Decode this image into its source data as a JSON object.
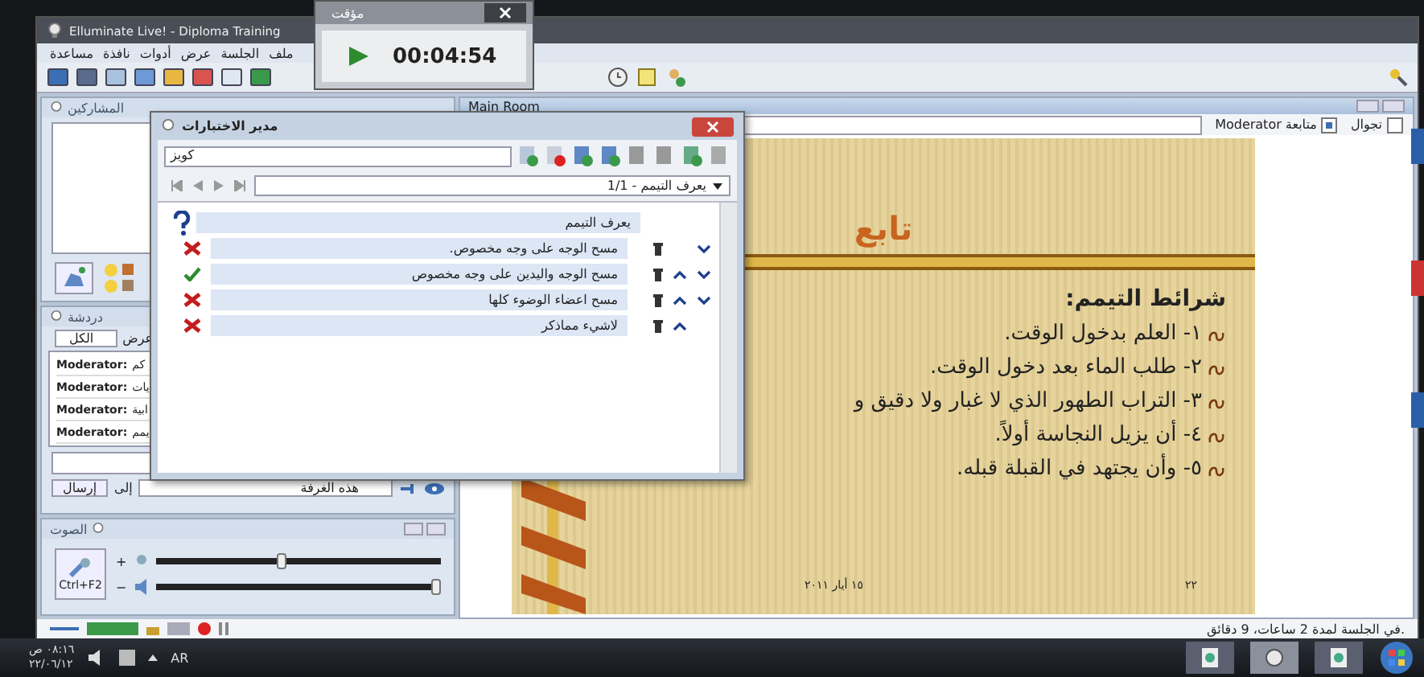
{
  "main_window": {
    "title": "Elluminate Live! - Diploma Training",
    "menu": [
      "ملف",
      "الجلسة",
      "عرض",
      "أدوات",
      "نافذة",
      "مساعدة"
    ]
  },
  "participants": {
    "title": "المشاركين"
  },
  "chat": {
    "title": "دردشة",
    "filter_label": "عرض",
    "filter_tab": "الكل",
    "messages": [
      {
        "sender": "Moderator:",
        "text": "كم"
      },
      {
        "sender": "Moderator:",
        "text": "يات"
      },
      {
        "sender": "Moderator:",
        "text": "ابية"
      },
      {
        "sender": "Moderator:",
        "text": "يمم"
      }
    ],
    "recipient": "هذه الغرفة",
    "to_label": "إلى",
    "send": "إرسال"
  },
  "audio": {
    "title": "الصوت",
    "talk_shortcut": "Ctrl+F2",
    "plus": "+",
    "minus": "−",
    "mic": {
      "level": 0.44
    },
    "speaker": {
      "level": 1
    }
  },
  "whiteboard": {
    "title": "Main Room",
    "roam": {
      "label": "تجوال",
      "checked": false
    },
    "follow": {
      "label": "متابعة Moderator",
      "checked": true
    }
  },
  "slide": {
    "title": "تابع",
    "heading": "شرائط التيمم:",
    "items": [
      "١- العلم بدخول الوقت.",
      "٢- طلب الماء بعد دخول الوقت.",
      "٣- التراب الطهور الذي لا غبار ولا دقيق و",
      "٤- أن يزيل النجاسة أولاً.",
      "٥- وأن يجتهد في القبلة قبله."
    ],
    "date": "١٥ أيار ٢٠١١",
    "page": "٢٢"
  },
  "status_bar": "في الجلسة لمدة 2 ساعات، 9 دقائق.",
  "timer": {
    "title": "مؤقت",
    "time": "00:04:54",
    "running": true
  },
  "quiz": {
    "title": "مدير الاختبارات",
    "search": "كويز",
    "position": "1/1 - يعرف التيمم",
    "question": "يعرف التيمم",
    "answers": [
      {
        "text": "مسح الوجه على وجه مخصوص.",
        "correct": false,
        "move_up": false,
        "move_down": true
      },
      {
        "text": "مسح الوجه واليدين على وجه مخصوص",
        "correct": true,
        "move_up": true,
        "move_down": true
      },
      {
        "text": "مسح اعضاء الوضوء كلها",
        "correct": false,
        "move_up": true,
        "move_down": true
      },
      {
        "text": "لاشيء مماذكر",
        "correct": false,
        "move_up": true,
        "move_down": false
      }
    ]
  },
  "taskbar": {
    "time": "٠٨:١٦ ص",
    "date": "٢٢/٠٦/١٢",
    "language": "AR"
  }
}
